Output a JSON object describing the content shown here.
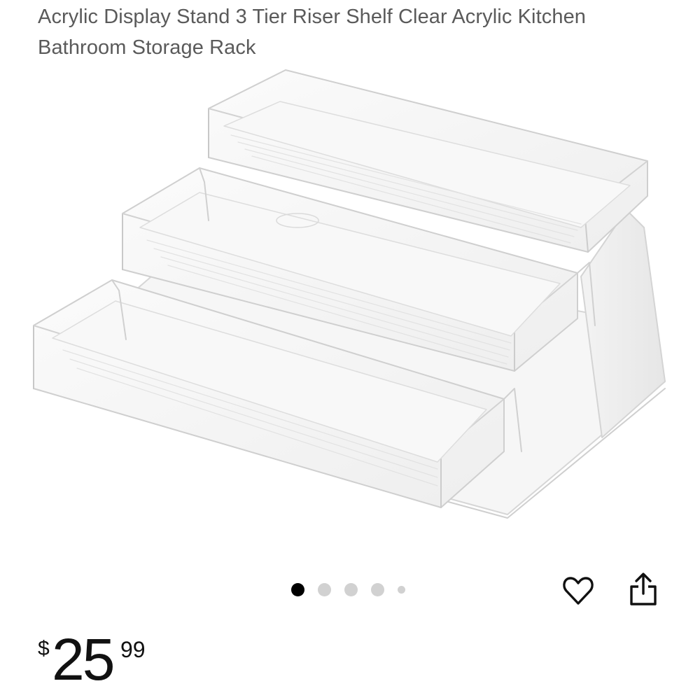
{
  "product": {
    "title": "Acrylic Display Stand 3 Tier Riser Shelf Clear Acrylic Kitchen Bathroom Storage Rack",
    "image_alt": "Clear acrylic three tier riser shelf"
  },
  "gallery": {
    "image_count": 5,
    "active_index": 0
  },
  "actions": {
    "favorite_icon": "heart-icon",
    "share_icon": "share-icon"
  },
  "price": {
    "currency": "$",
    "dollars": "25",
    "cents": "99"
  },
  "colors": {
    "title": "#5a5a5a",
    "dot_active": "#000000",
    "dot_inactive": "#d1d1d1",
    "price": "#111111"
  }
}
